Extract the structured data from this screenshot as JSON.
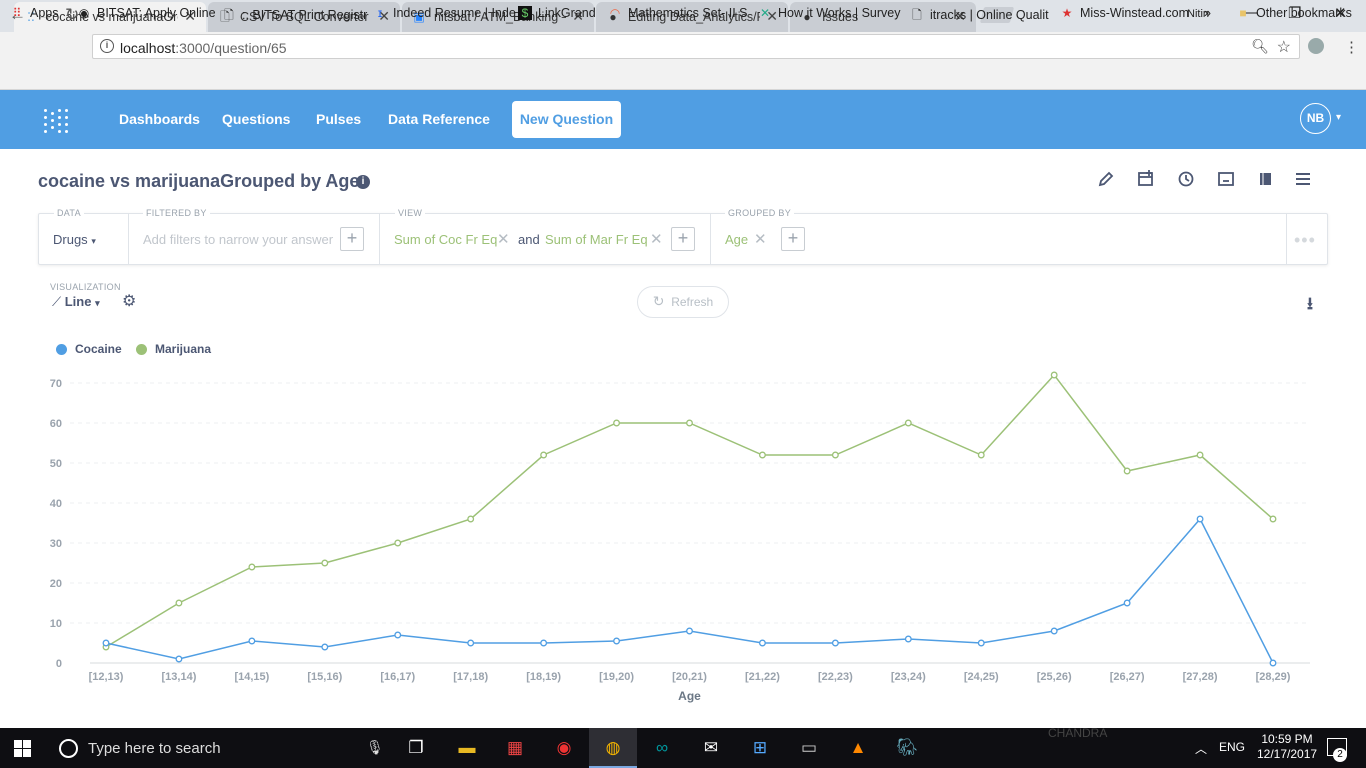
{
  "browser": {
    "tabs": [
      {
        "title": "cocaine vs marijuanaGro",
        "icon": "metabase-favicon",
        "active": true
      },
      {
        "title": "CSV To SQL Converter",
        "icon": "page-icon",
        "active": false
      },
      {
        "title": "nitsbat / ATM_Banking —",
        "icon": "bitbucket-icon",
        "active": false
      },
      {
        "title": "Editing Data_Analytics/RI",
        "icon": "github-icon",
        "active": false
      },
      {
        "title": "Issues",
        "icon": "github-icon",
        "active": false
      }
    ],
    "user": "Nitin",
    "url_host": "localhost",
    "url_path": ":3000/question/65",
    "bookmarks": [
      {
        "label": "Apps",
        "icon": "apps-grid-icon"
      },
      {
        "label": "BITSAT: Apply Online",
        "icon": "bitsat-icon"
      },
      {
        "label": ":. BITSAT Print Registr",
        "icon": "page-icon"
      },
      {
        "label": "Indeed Resume | Inde",
        "icon": "indeed-icon"
      },
      {
        "label": "LinkGrand",
        "icon": "dollar-icon"
      },
      {
        "label": "Mathematics Set- II S",
        "icon": "rainbow-icon"
      },
      {
        "label": "How it Works | Survey",
        "icon": "cross-icon"
      },
      {
        "label": "itracks | Online Qualit",
        "icon": "page-icon"
      },
      {
        "label": "Miss-Winstead.com",
        "icon": "star-icon"
      },
      {
        "label": "Other bookmarks",
        "icon": "folder-icon"
      }
    ],
    "bookmarks_overflow": "»"
  },
  "nav": {
    "links": [
      "Dashboards",
      "Questions",
      "Pulses",
      "Data Reference"
    ],
    "new_question": "New Question",
    "avatar": "NB"
  },
  "question": {
    "title": "cocaine vs marijuanaGrouped by Age"
  },
  "builder": {
    "data_label": "DATA",
    "data_value": "Drugs",
    "filter_label": "FILTERED BY",
    "filter_placeholder": "Add filters to narrow your answer",
    "view_label": "VIEW",
    "metric1": "Sum of Coc Fr Eq",
    "and": "and",
    "metric2": "Sum of Mar Fr Eq",
    "grouped_label": "GROUPED BY",
    "group_value": "Age"
  },
  "viz": {
    "label": "VISUALIZATION",
    "type": "Line",
    "refresh": "Refresh"
  },
  "chart_data": {
    "type": "line",
    "xlabel": "Age",
    "ylabel": "",
    "ylim": [
      0,
      72
    ],
    "yticks": [
      0,
      10,
      20,
      30,
      40,
      50,
      60,
      70
    ],
    "grid": true,
    "legend_placement": "top-left",
    "categories": [
      "[12,13)",
      "[13,14)",
      "[14,15)",
      "[15,16)",
      "[16,17)",
      "[17,18)",
      "[18,19)",
      "[19,20)",
      "[20,21)",
      "[21,22)",
      "[22,23)",
      "[23,24)",
      "[24,25)",
      "[25,26)",
      "[26,27)",
      "[27,28)",
      "[28,29)"
    ],
    "series": [
      {
        "name": "Cocaine",
        "color": "#509ee3",
        "values": [
          5,
          1,
          5.5,
          4,
          7,
          5,
          5,
          5.5,
          8,
          5,
          5,
          6,
          5,
          8,
          15,
          36,
          0
        ]
      },
      {
        "name": "Marijuana",
        "color": "#9cc177",
        "values": [
          4,
          15,
          24,
          25,
          30,
          36,
          52,
          60,
          60,
          52,
          52,
          60,
          52,
          72,
          48,
          52,
          36
        ]
      }
    ]
  },
  "taskbar": {
    "search_placeholder": "Type here to search",
    "watermark": "CHANDRA",
    "language": "ENG",
    "time": "10:59 PM",
    "date": "12/17/2017",
    "notifications": "2"
  }
}
